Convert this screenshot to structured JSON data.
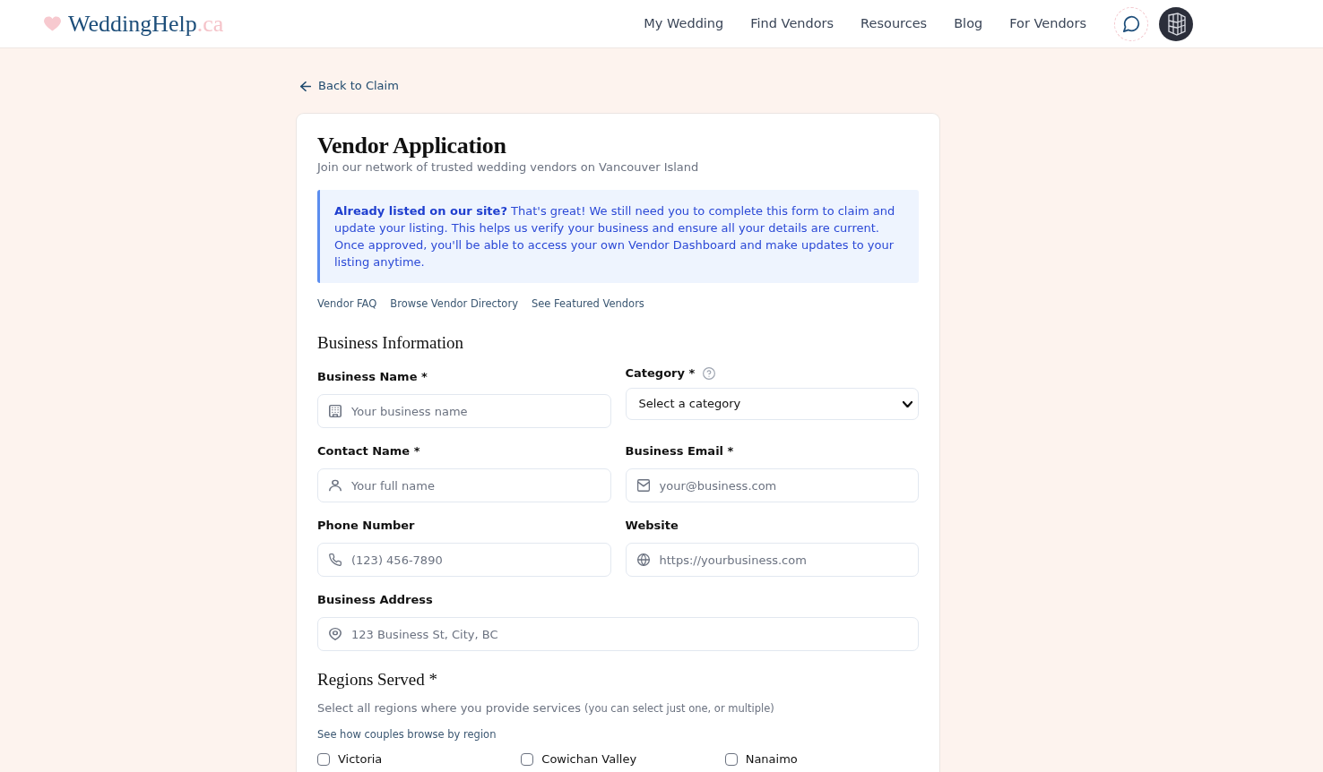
{
  "header": {
    "logo": {
      "name": "WeddingHelp",
      "suffix": ".ca"
    },
    "nav": [
      {
        "label": "My Wedding"
      },
      {
        "label": "Find Vendors"
      },
      {
        "label": "Resources"
      },
      {
        "label": "Blog"
      },
      {
        "label": "For Vendors"
      }
    ]
  },
  "back_link": "Back to Claim",
  "form": {
    "title": "Vendor Application",
    "subtitle": "Join our network of trusted wedding vendors on Vancouver Island",
    "notice": "**Already listed on our site?** That's great! We still need you to complete this form to claim and update your listing. This helps us verify your business and ensure all your details are current. Once approved, you'll be able to access your own Vendor Dashboard and make updates to your listing anytime.",
    "links": [
      "Vendor FAQ",
      "Browse Vendor Directory",
      "See Featured Vendors"
    ],
    "business_information": {
      "title": "Business Information",
      "fields": [
        {
          "kind": "business",
          "label": "Business Name *",
          "placeholder": "Your business name"
        },
        {
          "kind": "select",
          "label": "Category *",
          "help": true,
          "value": "Select a category"
        },
        {
          "kind": "person",
          "label": "Contact Name *",
          "placeholder": "Your full name"
        },
        {
          "kind": "email",
          "label": "Business Email *",
          "placeholder": "your@business.com"
        },
        {
          "kind": "phone",
          "label": "Phone Number",
          "placeholder": "(123) 456-7890"
        },
        {
          "kind": "website",
          "label": "Website",
          "placeholder": "https://yourbusiness.com"
        },
        {
          "kind": "address",
          "label": "Business Address",
          "placeholder": "123 Business St, City, BC",
          "wide": true
        }
      ]
    },
    "regions_served": {
      "title": "Regions Served *",
      "description": "Select all regions where you provide services",
      "note": "(you can select just one, or multiple)",
      "link": "See how couples browse by region",
      "regions": [
        {
          "label": "Victoria",
          "checked": false
        },
        {
          "label": "Cowichan Valley",
          "checked": false
        },
        {
          "label": "Nanaimo",
          "checked": false
        }
      ]
    }
  }
}
